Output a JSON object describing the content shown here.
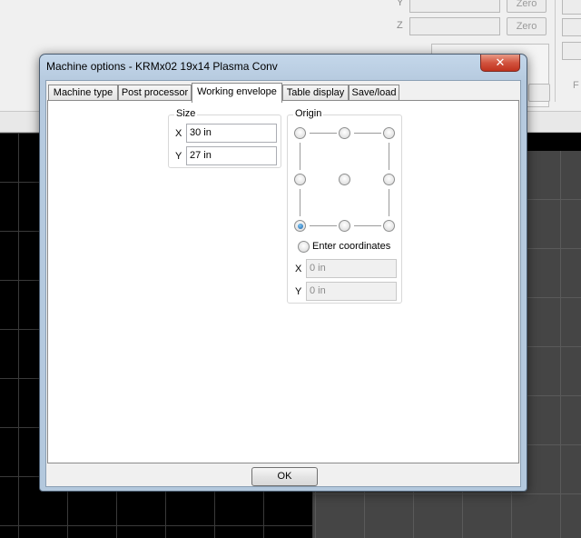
{
  "background": {
    "axis_labels": [
      "Y",
      "Z"
    ],
    "zero_labels": [
      "Zero",
      "Zero"
    ],
    "fragment": "F"
  },
  "dialog": {
    "title": "Machine options - KRMx02 19x14 Plasma Conv",
    "close_glyph": "✕",
    "tabs": [
      {
        "label": "Machine type",
        "active": false
      },
      {
        "label": "Post processor",
        "active": false
      },
      {
        "label": "Working envelope",
        "active": true
      },
      {
        "label": "Table display",
        "active": false
      },
      {
        "label": "Save/load",
        "active": false
      }
    ],
    "size": {
      "group_label": "Size",
      "x_label": "X",
      "x_value": "30 in",
      "y_label": "Y",
      "y_value": "27 in"
    },
    "origin": {
      "group_label": "Origin",
      "selected": "bottom-left",
      "enter_coordinates_label": "Enter coordinates",
      "x_label": "X",
      "x_value": "0 in",
      "y_label": "Y",
      "y_value": "0 in"
    },
    "ok_label": "OK"
  }
}
